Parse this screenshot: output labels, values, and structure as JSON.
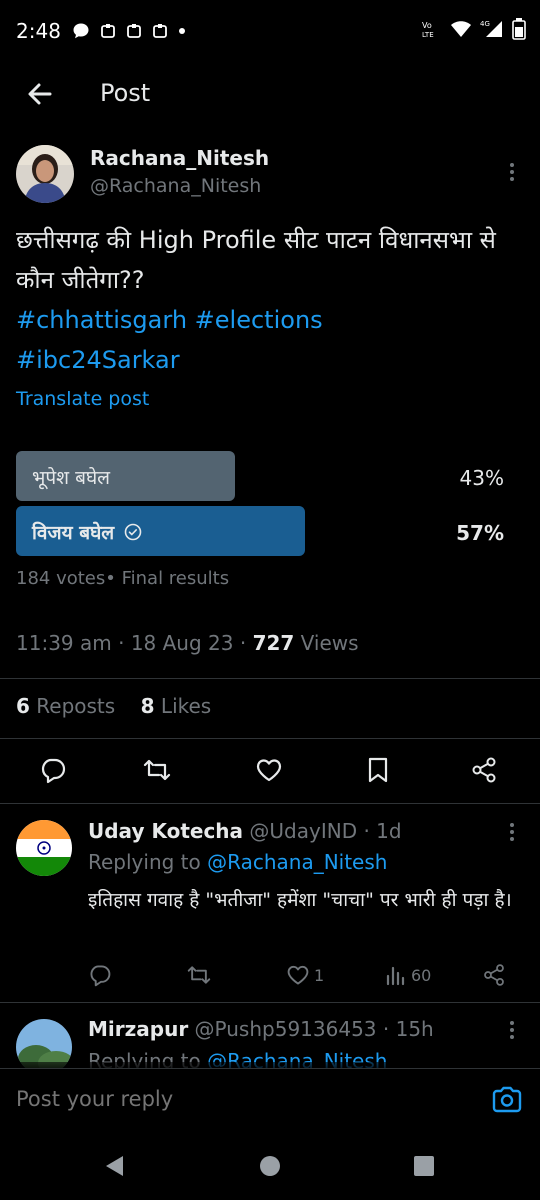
{
  "status_bar": {
    "time": "2:48",
    "network_label": "Vo) LTE",
    "network_type": "4G"
  },
  "header": {
    "title": "Post"
  },
  "post": {
    "author_name": "Rachana_Nitesh",
    "author_handle": "@Rachana_Nitesh",
    "text": "छत्तीसगढ़ की High Profile सीट पाटन विधानसभा से कौन जीतेगा??",
    "hashtag_1": "#chhattisgarh",
    "hashtag_2": "#elections",
    "hashtag_3": "#ibc24Sarkar",
    "translate_label": "Translate post",
    "poll": {
      "options": [
        {
          "label": "भूपेश बघेल",
          "percent": "43%",
          "fraction": 0.43,
          "winner": false
        },
        {
          "label": "विजय बघेल",
          "percent": "57%",
          "fraction": 0.57,
          "winner": true
        }
      ],
      "meta": "184 votes• Final results"
    },
    "time": "11:39 am",
    "date": "18 Aug 23",
    "views_count": "727",
    "views_label": "Views",
    "reposts_count": "6",
    "reposts_label": "Reposts",
    "likes_count": "8",
    "likes_label": "Likes"
  },
  "replies": [
    {
      "name": "Uday Kotecha",
      "handle": "@UdayIND",
      "age": "1d",
      "replying_prefix": "Replying to",
      "replying_to": "@Rachana_Nitesh",
      "text": "इतिहास गवाह है \"भतीजा\" हमेंशा \"चाचा\" पर भारी ही पड़ा है।",
      "likes": "1",
      "views": "60"
    },
    {
      "name": "Mirzapur",
      "handle": "@Pushp59136453",
      "age": "15h",
      "replying_prefix": "Replying to",
      "replying_to": "@Rachana_Nitesh"
    }
  ],
  "reply_bar": {
    "placeholder": "Post your reply"
  },
  "colors": {
    "background": "#000000",
    "accent": "#1d9bf0",
    "muted": "#71767b",
    "poll_winner": "#1a5e92",
    "poll_other": "#536471"
  }
}
